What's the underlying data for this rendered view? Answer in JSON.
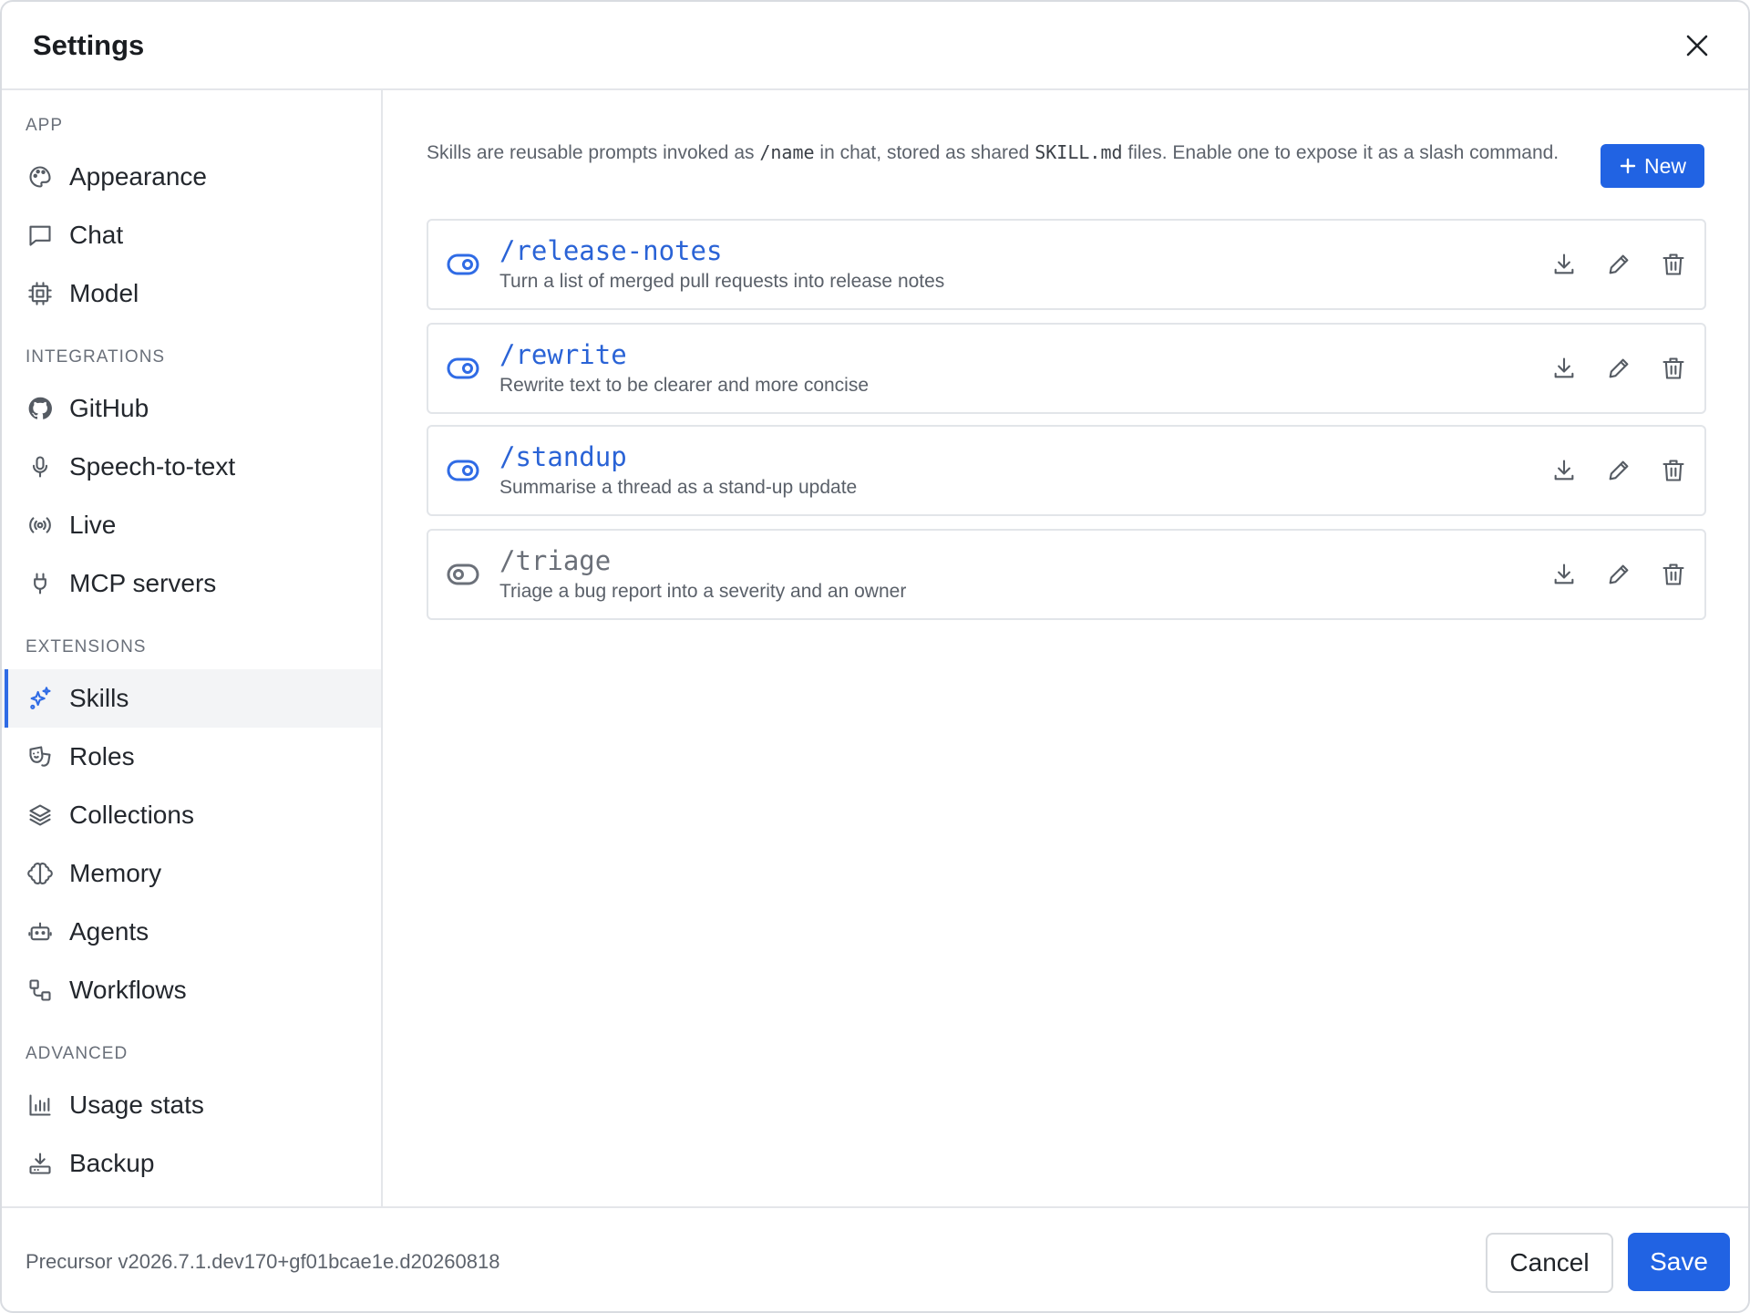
{
  "header": {
    "title": "Settings"
  },
  "sidebar": {
    "sections": {
      "app": "APP",
      "integrations": "INTEGRATIONS",
      "extensions": "EXTENSIONS",
      "advanced": "ADVANCED"
    },
    "items": [
      {
        "label": "Appearance",
        "icon": "palette-icon"
      },
      {
        "label": "Chat",
        "icon": "chat-bubble-icon"
      },
      {
        "label": "Model",
        "icon": "chip-icon"
      },
      {
        "label": "GitHub",
        "icon": "github-icon"
      },
      {
        "label": "Speech-to-text",
        "icon": "microphone-icon"
      },
      {
        "label": "Live",
        "icon": "broadcast-icon"
      },
      {
        "label": "MCP servers",
        "icon": "plug-icon"
      },
      {
        "label": "Skills",
        "icon": "sparkles-icon",
        "active": true
      },
      {
        "label": "Roles",
        "icon": "masks-icon"
      },
      {
        "label": "Collections",
        "icon": "layers-icon"
      },
      {
        "label": "Memory",
        "icon": "brain-icon"
      },
      {
        "label": "Agents",
        "icon": "robot-icon"
      },
      {
        "label": "Workflows",
        "icon": "workflow-icon"
      },
      {
        "label": "Usage stats",
        "icon": "bar-chart-icon"
      },
      {
        "label": "Backup",
        "icon": "backup-icon"
      }
    ]
  },
  "main": {
    "intro": {
      "part1": "Skills are reusable prompts invoked as ",
      "code1": "/name",
      "part2": " in chat, stored as shared ",
      "code2": "SKILL.md",
      "part3": " files. Enable one to expose it as a slash command."
    },
    "new_button": "New",
    "skills": [
      {
        "name": "/release-notes",
        "description": "Turn a list of merged pull requests into release notes",
        "enabled": true
      },
      {
        "name": "/rewrite",
        "description": "Rewrite text to be clearer and more concise",
        "enabled": true
      },
      {
        "name": "/standup",
        "description": "Summarise a thread as a stand-up update",
        "enabled": true
      },
      {
        "name": "/triage",
        "description": "Triage a bug report into a severity and an owner",
        "enabled": false
      }
    ]
  },
  "footer": {
    "version": "Precursor v2026.7.1.dev170+gf01bcae1e.d20260818",
    "cancel": "Cancel",
    "save": "Save"
  },
  "colors": {
    "accent": "#2163e3",
    "active_indicator": "#2f6be5"
  }
}
